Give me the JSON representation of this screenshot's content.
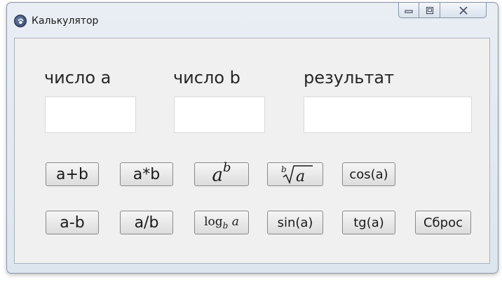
{
  "window": {
    "title": "Калькулятор",
    "controls": {
      "minimize_icon": "minimize-icon",
      "maximize_icon": "maximize-icon",
      "close_icon": "close-icon"
    }
  },
  "labels": {
    "a": "число a",
    "b": "число b",
    "result": "результат"
  },
  "inputs": {
    "a_value": "",
    "b_value": "",
    "result_value": ""
  },
  "buttons": {
    "add": "a+b",
    "multiply": "a*b",
    "power_base": "a",
    "power_exp": "b",
    "root_index": "b",
    "root_radicand": "a",
    "cos": "cos(a)",
    "subtract": "a-b",
    "divide": "a/b",
    "log_name": "log",
    "log_base": "b",
    "log_arg": "a",
    "sin": "sin(a)",
    "tg": "tg(a)",
    "reset": "Сброс"
  }
}
